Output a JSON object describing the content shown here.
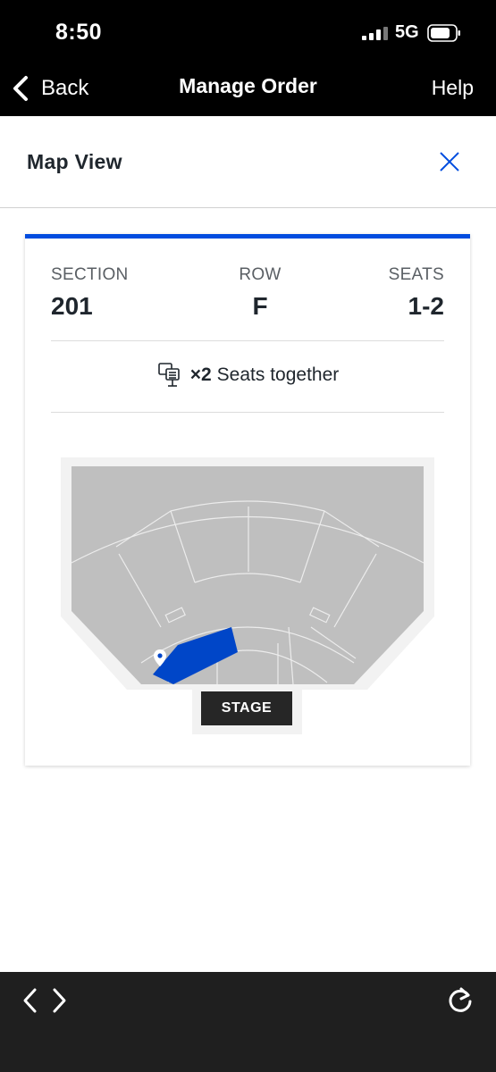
{
  "status_bar": {
    "time": "8:50",
    "network": "5G"
  },
  "nav": {
    "back_label": "Back",
    "title": "Manage Order",
    "help_label": "Help"
  },
  "sheet": {
    "title": "Map View"
  },
  "ticket": {
    "section_label": "SECTION",
    "section_value": "201",
    "row_label": "ROW",
    "row_value": "F",
    "seats_label": "SEATS",
    "seats_value": "1-2",
    "together_count": "×2",
    "together_text": "Seats together"
  },
  "map": {
    "stage_label": "STAGE"
  },
  "colors": {
    "accent": "#024ddf",
    "map_gray": "#bfbfbf",
    "selected_section": "#0046c8"
  },
  "icons": [
    "chevron-left-icon",
    "close-icon",
    "seats-together-icon",
    "location-pin-icon",
    "browser-back-icon",
    "browser-forward-icon",
    "reload-icon",
    "signal-icon",
    "battery-icon"
  ]
}
